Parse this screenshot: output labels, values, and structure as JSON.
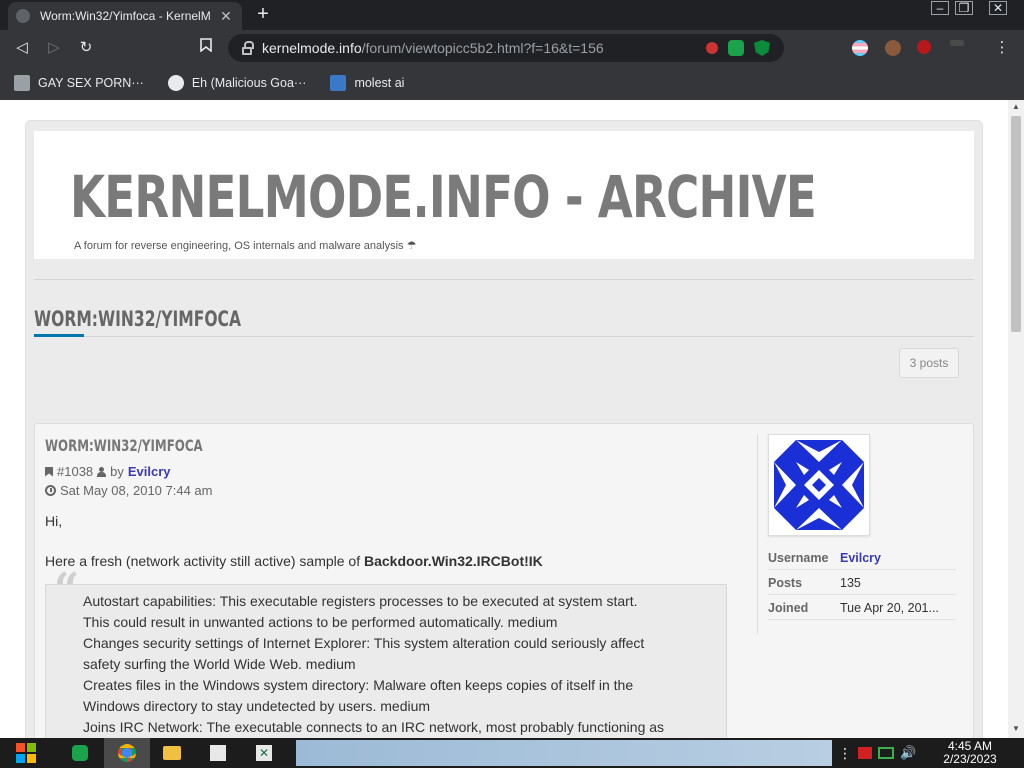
{
  "browser": {
    "tab_title": "Worm:Win32/Yimfoca - KernelM",
    "tab_close": "✕",
    "newtab": "+",
    "url_host": "kernelmode.info",
    "url_path": "/forum/viewtopicc5b2.html?f=16&t=156",
    "win_min": "–",
    "win_max": "❐",
    "win_close": "✕"
  },
  "bookmarks": [
    {
      "label": "GAY SEX PORN···",
      "icon": "bookmark-favicon"
    },
    {
      "label": "Eh (Malicious Goa···",
      "icon": "globe-icon"
    },
    {
      "label": "molest ai",
      "icon": "bookmark-favicon"
    }
  ],
  "page": {
    "site_title": "KERNELMODE.INFO - ARCHIVE",
    "site_description": "A forum for reverse engineering, OS internals and malware analysis ☂",
    "topic_title": "WORM:WIN32/YIMFOCA",
    "post_count": "3 posts"
  },
  "post": {
    "title": "WORM:WIN32/YIMFOCA",
    "post_id": "#1038",
    "by": "by",
    "author": "Evilcry",
    "date": "Sat May 08, 2010 7:44 am",
    "greeting": "Hi,",
    "intro_prefix": "Here a fresh (network activity still active) sample of ",
    "intro_bold": "Backdoor.Win32.IRCBot!IK",
    "quote_lines": [
      "Autostart capabilities: This executable registers processes to be executed at system start.",
      "This could result in unwanted actions to be performed automatically. medium",
      "Changes security settings of Internet Explorer: This system alteration could seriously affect",
      "safety surfing the World Wide Web. medium",
      "Creates files in the Windows system directory: Malware often keeps copies of itself in the",
      "Windows directory to stay undetected by users. medium",
      "Joins IRC Network: The executable connects to an IRC network, most probably functioning as"
    ]
  },
  "profile": {
    "rows": [
      {
        "key": "Username",
        "value": "Evilcry",
        "link": true
      },
      {
        "key": "Posts",
        "value": "135",
        "link": false
      },
      {
        "key": "Joined",
        "value": "Tue Apr 20, 201...",
        "link": false
      }
    ]
  },
  "taskbar": {
    "time": "4:45 AM",
    "date": "2/23/2023"
  },
  "colors": {
    "link": "#3b3bb8",
    "accent": "#0076b1",
    "avatar": "#1b2fd6"
  }
}
